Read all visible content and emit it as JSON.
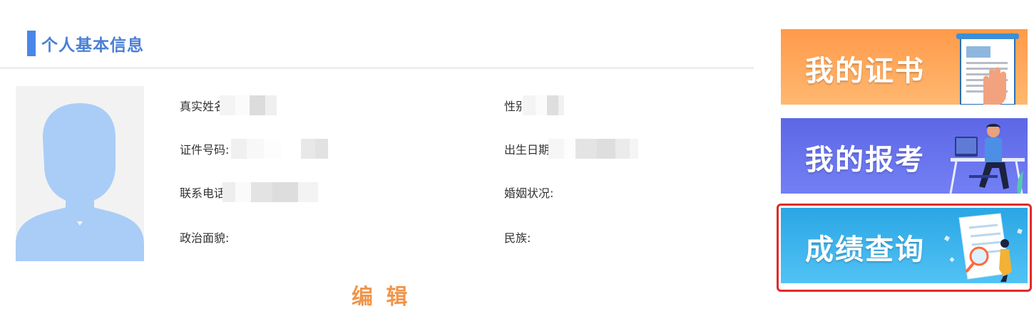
{
  "section": {
    "title": "个人基本信息"
  },
  "profile": {
    "fields": {
      "real_name": {
        "label": "真实姓名:",
        "value": ""
      },
      "gender": {
        "label": "性别:",
        "value": ""
      },
      "id_number": {
        "label": "证件号码:",
        "value": ""
      },
      "birth_date": {
        "label": "出生日期:",
        "value": ""
      },
      "phone": {
        "label": "联系电话:",
        "value": ""
      },
      "marital_status": {
        "label": "婚姻状况:",
        "value": ""
      },
      "political_status": {
        "label": "政治面貌:",
        "value": ""
      },
      "ethnicity": {
        "label": "民族:",
        "value": ""
      }
    },
    "edit_label": "编 辑"
  },
  "banners": {
    "certificate": {
      "label": "我的证书",
      "icon": "certificate-document-icon",
      "color": "#ff9a4a"
    },
    "registration": {
      "label": "我的报考",
      "icon": "person-at-desk-icon",
      "color": "#5d67e6"
    },
    "score_query": {
      "label": "成绩查询",
      "icon": "magnifier-report-icon",
      "color": "#2aa6e4",
      "selected": true
    }
  },
  "colors": {
    "accent": "#4a86e8",
    "edit": "#f0954a",
    "highlight": "#e02a2a"
  }
}
